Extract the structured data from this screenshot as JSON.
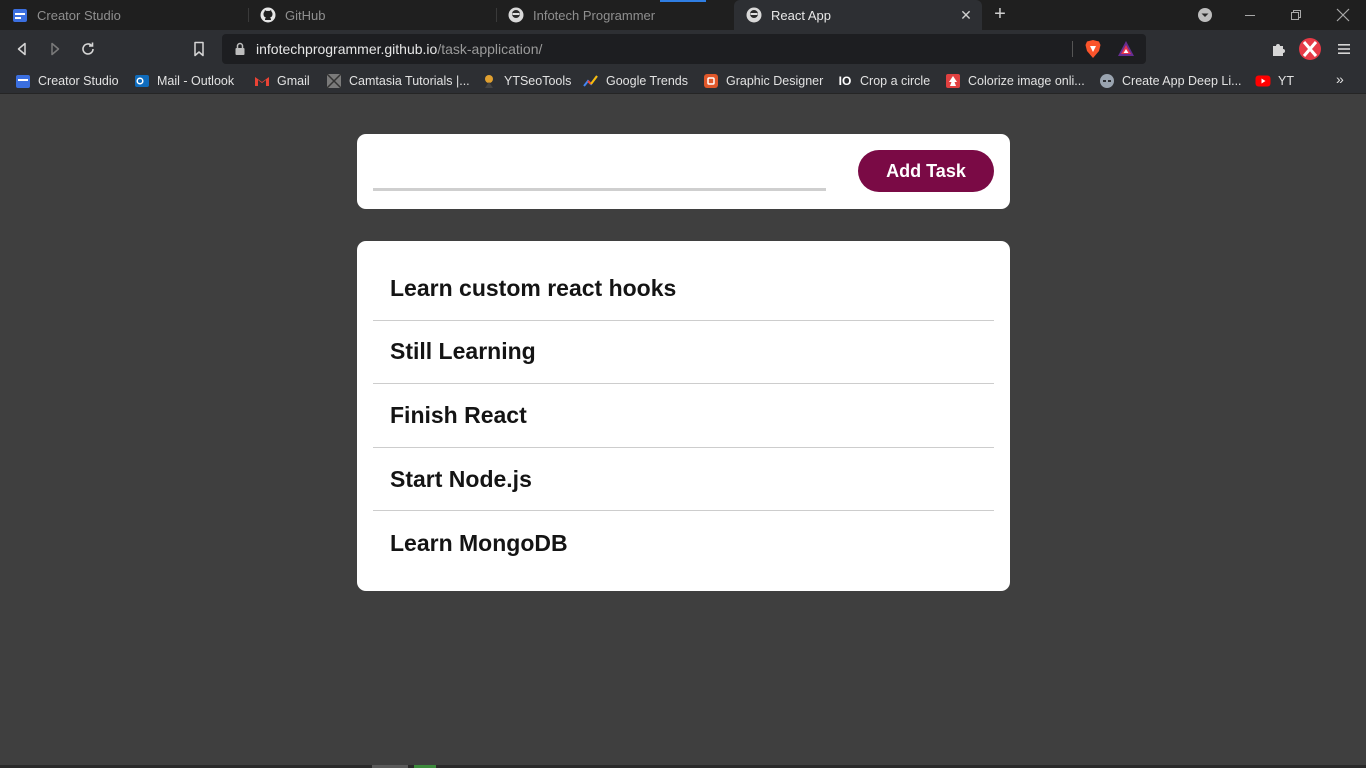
{
  "tabs": [
    {
      "title": "Creator Studio",
      "icon": "creator-studio-icon"
    },
    {
      "title": "GitHub",
      "icon": "github-icon"
    },
    {
      "title": "Infotech Programmer",
      "icon": "site-favicon"
    },
    {
      "title": "React App",
      "icon": "site-favicon",
      "active": true
    }
  ],
  "newtab_symbol": "+",
  "url": {
    "host": "infotechprogrammer.github.io",
    "path": "/task-application/"
  },
  "bookmarks": [
    {
      "label": "Creator Studio",
      "icon": "creator-studio-icon",
      "color": "#3b6fe0"
    },
    {
      "label": "Mail - Outlook",
      "icon": "outlook-icon",
      "color": "#0f6cbd"
    },
    {
      "label": "Gmail",
      "icon": "gmail-icon",
      "color": "#ea4335"
    },
    {
      "label": "Camtasia Tutorials |...",
      "icon": "camtasia-icon",
      "color": "#7a7a7a"
    },
    {
      "label": "YTSeoTools",
      "icon": "ytseotools-icon",
      "color": "#e0a030"
    },
    {
      "label": "Google Trends",
      "icon": "google-trends-icon",
      "color": "#4285f4"
    },
    {
      "label": "Graphic Designer",
      "icon": "graphic-designer-icon",
      "color": "#e0572a"
    },
    {
      "label": "Crop a circle",
      "icon": "crop-circle-icon",
      "color": "#ffffff"
    },
    {
      "label": "Colorize image onli...",
      "icon": "colorize-icon",
      "color": "#e04040"
    },
    {
      "label": "Create App Deep Li...",
      "icon": "deeplink-icon",
      "color": "#9aa4b0"
    },
    {
      "label": "YT",
      "icon": "youtube-icon",
      "color": "#ff0000"
    }
  ],
  "bookmarks_overflow": "»",
  "task_input": {
    "value": "",
    "placeholder": ""
  },
  "add_button_label": "Add Task",
  "tasks": [
    "Learn custom react hooks",
    "Still Learning",
    "Finish React",
    "Start Node.js",
    "Learn MongoDB"
  ],
  "colors": {
    "page_bg": "#3f3f3f",
    "card_bg": "#ffffff",
    "button_bg": "#7a0a45"
  }
}
